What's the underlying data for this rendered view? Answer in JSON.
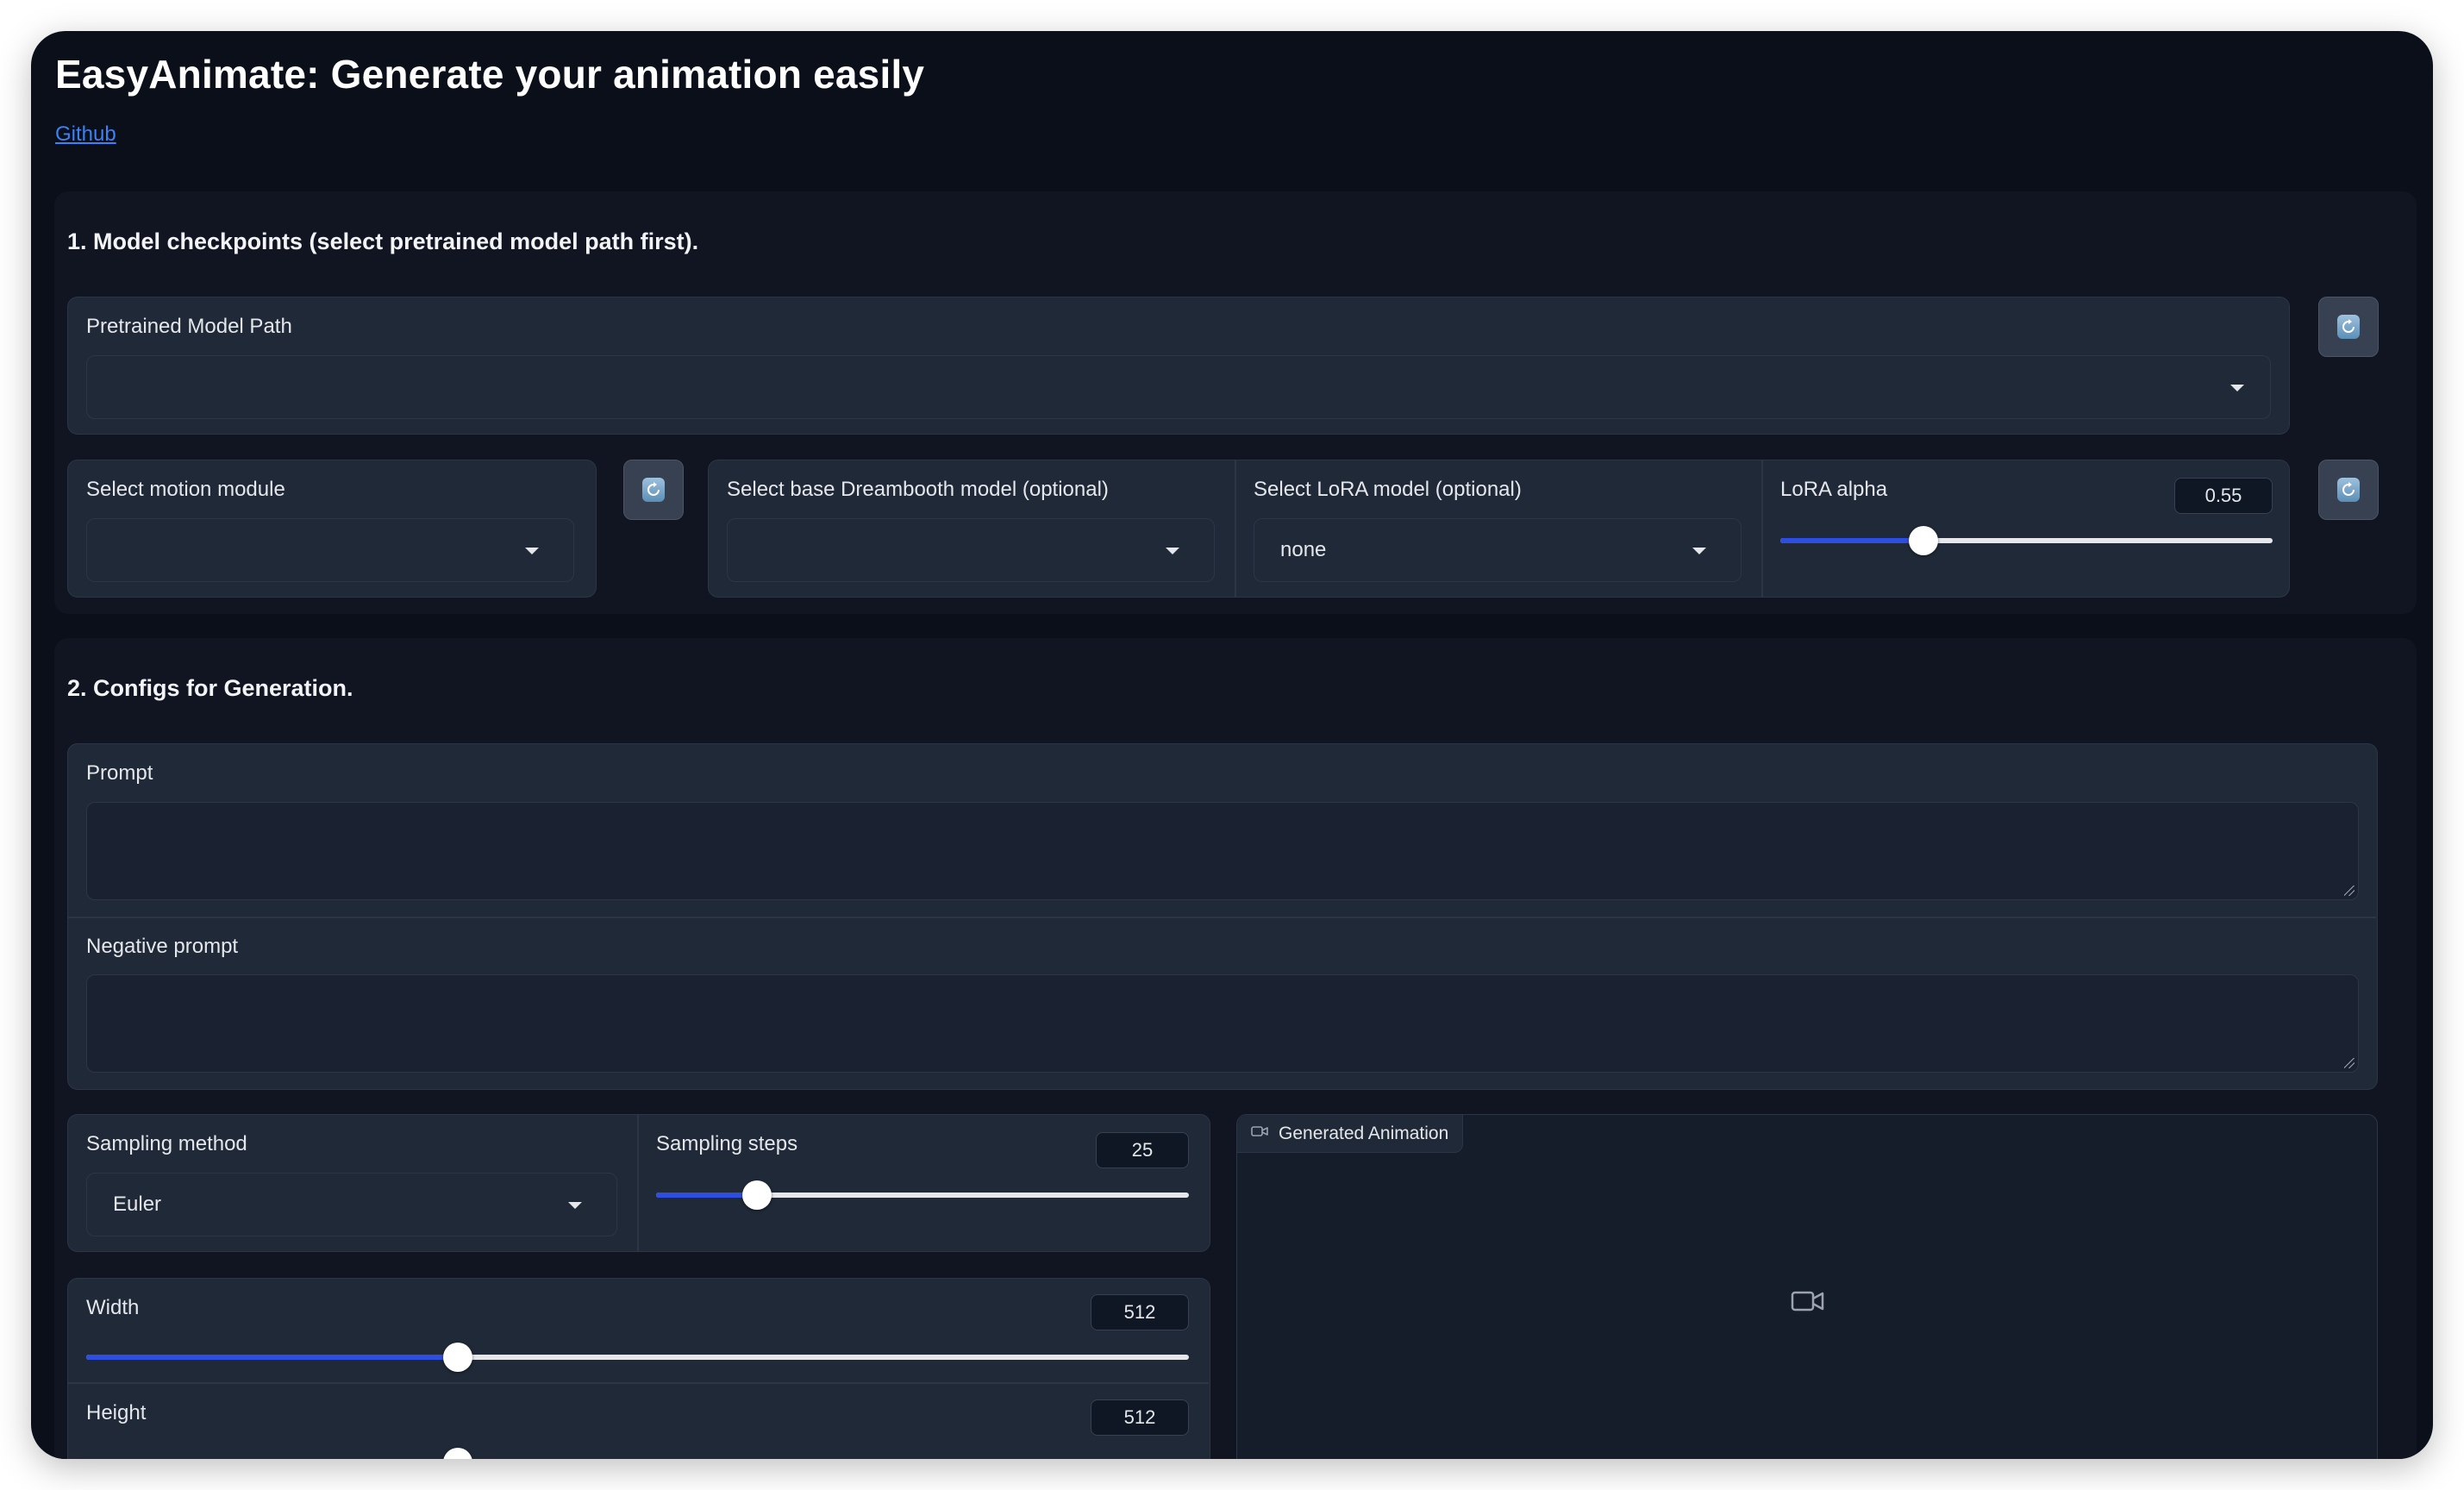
{
  "page": {
    "title": "EasyAnimate: Generate your animation easily",
    "github_link": "Github"
  },
  "section1": {
    "heading": "1. Model checkpoints (select pretrained model path first).",
    "pretrained_model_path": {
      "label": "Pretrained Model Path",
      "value": ""
    },
    "motion_module": {
      "label": "Select motion module",
      "value": ""
    },
    "base_dreambooth": {
      "label": "Select base Dreambooth model (optional)",
      "value": ""
    },
    "lora_model": {
      "label": "Select LoRA model (optional)",
      "value": "none"
    },
    "lora_alpha": {
      "label": "LoRA alpha",
      "value": "0.55",
      "fraction": 0.29
    }
  },
  "section2": {
    "heading": "2. Configs for Generation.",
    "prompt": {
      "label": "Prompt",
      "value": ""
    },
    "negative_prompt": {
      "label": "Negative prompt",
      "value": ""
    },
    "sampling_method": {
      "label": "Sampling method",
      "value": "Euler"
    },
    "sampling_steps": {
      "label": "Sampling steps",
      "value": "25",
      "fraction": 0.19
    },
    "width": {
      "label": "Width",
      "value": "512",
      "fraction": 0.337
    },
    "height": {
      "label": "Height",
      "value": "512",
      "fraction": 0.337
    },
    "output": {
      "label": "Generated Animation"
    }
  },
  "icons": [
    "refresh-icon",
    "chevron-down-icon",
    "video-camera-icon"
  ],
  "colors": {
    "background": "#0b0f19",
    "panel": "#1f2937",
    "accent": "#2d4ee0",
    "link": "#3b82f6"
  }
}
